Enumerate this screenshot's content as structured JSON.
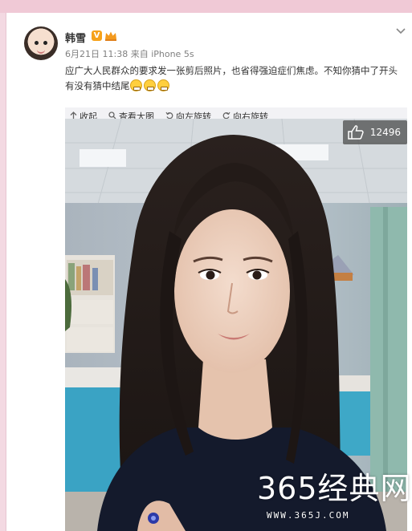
{
  "post": {
    "username": "韩雪",
    "verified_badge": "V",
    "date": "6月21日 11:38",
    "source": "来自 iPhone 5s",
    "text": "应广大人民群众的要求发一张剪后照片，也省得强迫症们焦虑。不知你猜中了开头有没有猜中结尾",
    "emoji_count": 3
  },
  "toolbar": {
    "collapse": "收起",
    "view_large": "查看大图",
    "rotate_left": "向左旋转",
    "rotate_right": "向右旋转"
  },
  "photo": {
    "like_count": "12496"
  },
  "watermark": {
    "text": "365经典网",
    "url": "WWW.365J.COM"
  },
  "icons": [
    "chevron-down-icon",
    "up-arrow-icon",
    "magnifier-icon",
    "rotate-left-icon",
    "rotate-right-icon",
    "thumbs-up-icon",
    "grin-emoji-icon"
  ],
  "colors": {
    "background": "#f3d9e2",
    "verified": "#f6a21a",
    "toolbar": "#f2f2f5"
  }
}
